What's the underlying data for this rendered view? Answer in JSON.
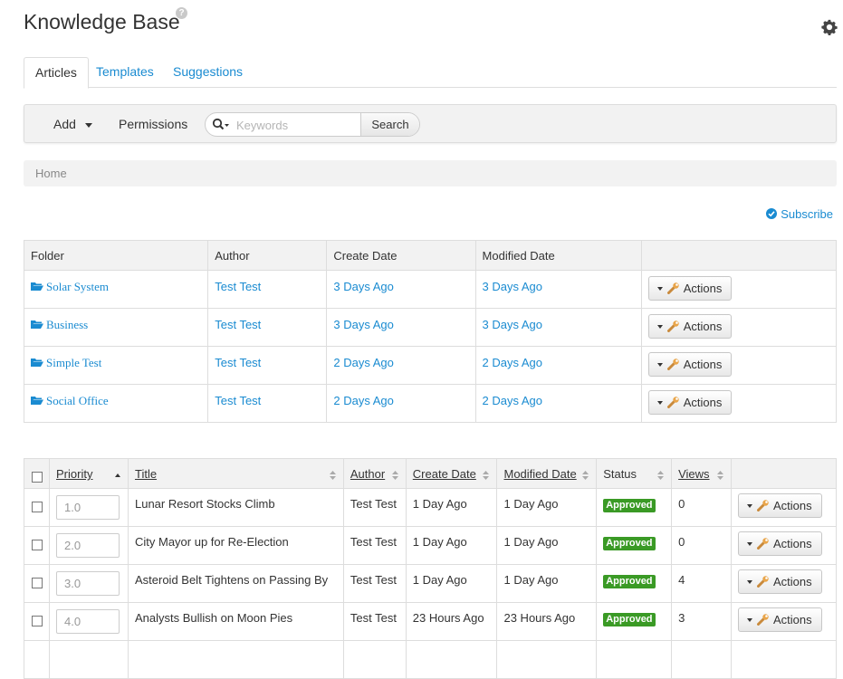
{
  "header": {
    "title": "Knowledge Base",
    "help_glyph": "?"
  },
  "tabs": [
    {
      "label": "Articles",
      "active": true
    },
    {
      "label": "Templates",
      "active": false
    },
    {
      "label": "Suggestions",
      "active": false
    }
  ],
  "toolbar": {
    "add_label": "Add",
    "permissions_label": "Permissions",
    "search_placeholder": "Keywords",
    "search_button": "Search"
  },
  "breadcrumb": "Home",
  "subscribe_label": "Subscribe",
  "folders": {
    "columns": [
      "Folder",
      "Author",
      "Create Date",
      "Modified Date",
      ""
    ],
    "rows": [
      {
        "name": "Solar System",
        "author": "Test Test",
        "created": "3 Days Ago",
        "modified": "3 Days Ago",
        "actions": "Actions"
      },
      {
        "name": "Business",
        "author": "Test Test",
        "created": "3 Days Ago",
        "modified": "3 Days Ago",
        "actions": "Actions"
      },
      {
        "name": "Simple Test",
        "author": "Test Test",
        "created": "2 Days Ago",
        "modified": "2 Days Ago",
        "actions": "Actions"
      },
      {
        "name": "Social Office",
        "author": "Test Test",
        "created": "2 Days Ago",
        "modified": "2 Days Ago",
        "actions": "Actions"
      }
    ]
  },
  "articles": {
    "columns": [
      "Priority",
      "Title",
      "Author",
      "Create Date",
      "Modified Date",
      "Status",
      "Views"
    ],
    "rows": [
      {
        "priority": "1.0",
        "title": "Lunar Resort Stocks Climb",
        "author": "Test Test",
        "created": "1 Day Ago",
        "modified": "1 Day Ago",
        "status": "Approved",
        "views": "0",
        "actions": "Actions"
      },
      {
        "priority": "2.0",
        "title": "City Mayor up for Re-Election",
        "author": "Test Test",
        "created": "1 Day Ago",
        "modified": "1 Day Ago",
        "status": "Approved",
        "views": "0",
        "actions": "Actions"
      },
      {
        "priority": "3.0",
        "title": "Asteroid Belt Tightens on Passing By",
        "author": "Test Test",
        "created": "1 Day Ago",
        "modified": "1 Day Ago",
        "status": "Approved",
        "views": "4",
        "actions": "Actions"
      },
      {
        "priority": "4.0",
        "title": "Analysts Bullish on Moon Pies",
        "author": "Test Test",
        "created": "23 Hours Ago",
        "modified": "23 Hours Ago",
        "status": "Approved",
        "views": "3",
        "actions": "Actions"
      }
    ]
  },
  "colors": {
    "link": "#1a8bd1",
    "approved": "#3a9a25",
    "panel_bg": "#f2f2f2"
  }
}
